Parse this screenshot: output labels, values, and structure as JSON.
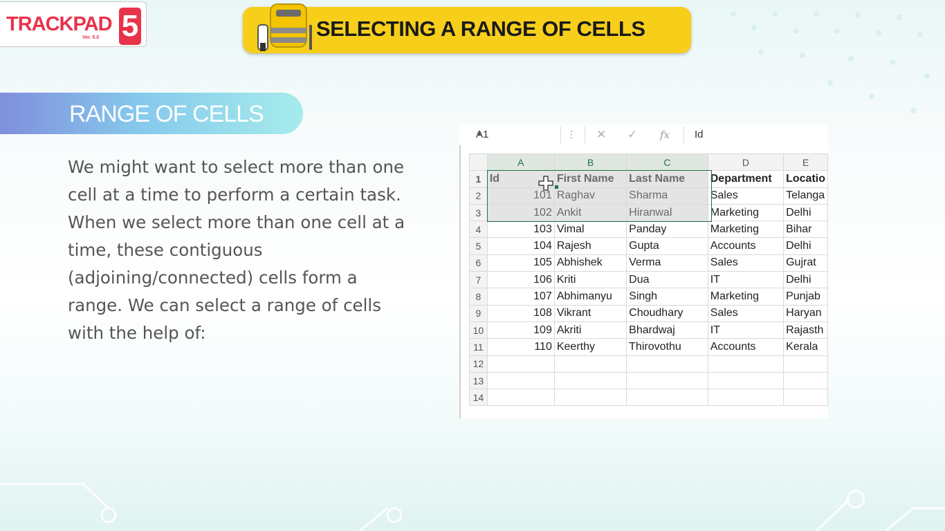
{
  "logo": {
    "word": "TRACKPAD",
    "number": "5",
    "version": "Ver. 5.0"
  },
  "title_banner": {
    "text": "SELECTING A RANGE OF CELLS",
    "color": "#f7cf1b"
  },
  "section": {
    "title": "RANGE OF CELLS"
  },
  "body": {
    "text": "We might want to select more than one cell at a time to perform a certain task. When we select more than one cell at a time, these contiguous (adjoining/connected) cells form a range. We can select a range of cells with the help of:"
  },
  "excel": {
    "name_box": "A1",
    "formula_content": "Id",
    "cancel_icon": "✕",
    "enter_icon": "✓",
    "fx_label": "fx",
    "columns": [
      "A",
      "B",
      "C",
      "D",
      "E"
    ],
    "rows": [
      {
        "n": "1",
        "a": "Id",
        "b": "First Name",
        "c": "Last Name",
        "d": "Department",
        "e": "Locatio"
      },
      {
        "n": "2",
        "a": "101",
        "b": "Raghav",
        "c": "Sharma",
        "d": "Sales",
        "e": "Telanga"
      },
      {
        "n": "3",
        "a": "102",
        "b": "Ankit",
        "c": "Hiranwal",
        "d": "Marketing",
        "e": "Delhi"
      },
      {
        "n": "4",
        "a": "103",
        "b": "Vimal",
        "c": "Panday",
        "d": "Marketing",
        "e": "Bihar"
      },
      {
        "n": "5",
        "a": "104",
        "b": "Rajesh",
        "c": "Gupta",
        "d": "Accounts",
        "e": "Delhi"
      },
      {
        "n": "6",
        "a": "105",
        "b": "Abhishek",
        "c": "Verma",
        "d": "Sales",
        "e": "Gujrat"
      },
      {
        "n": "7",
        "a": "106",
        "b": "Kriti",
        "c": "Dua",
        "d": "IT",
        "e": "Delhi"
      },
      {
        "n": "8",
        "a": "107",
        "b": "Abhimanyu",
        "c": "Singh",
        "d": "Marketing",
        "e": "Punjab"
      },
      {
        "n": "9",
        "a": "108",
        "b": "Vikrant",
        "c": "Choudhary",
        "d": "Sales",
        "e": "Haryan"
      },
      {
        "n": "10",
        "a": "109",
        "b": "Akriti",
        "c": "Bhardwaj",
        "d": "IT",
        "e": "Rajasth"
      },
      {
        "n": "11",
        "a": "110",
        "b": "Keerthy",
        "c": "Thirovothu",
        "d": "Accounts",
        "e": "Kerala"
      },
      {
        "n": "12",
        "a": "",
        "b": "",
        "c": "",
        "d": "",
        "e": ""
      },
      {
        "n": "13",
        "a": "",
        "b": "",
        "c": "",
        "d": "",
        "e": ""
      },
      {
        "n": "14",
        "a": "",
        "b": "",
        "c": "",
        "d": "",
        "e": ""
      }
    ],
    "selection": "A1:C3",
    "selection_color": "#217346",
    "cursor_icon": "cell-select-cross"
  }
}
